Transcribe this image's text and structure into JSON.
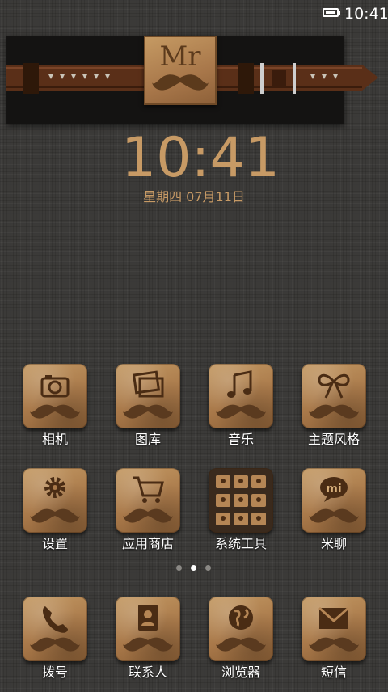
{
  "status_bar": {
    "time": "10:41",
    "battery_icon": "battery-icon"
  },
  "widget": {
    "tag_text": "Mr"
  },
  "clock": {
    "time": "10:41",
    "date": "星期四  07月11日"
  },
  "colors": {
    "clock": "#c79a65",
    "tile": "#a9794a",
    "mustache": "#5a3a1f"
  },
  "apps_page": [
    {
      "label": "相机",
      "icon": "camera-icon"
    },
    {
      "label": "图库",
      "icon": "gallery-icon"
    },
    {
      "label": "音乐",
      "icon": "music-note-icon"
    },
    {
      "label": "主题风格",
      "icon": "bow-icon"
    },
    {
      "label": "设置",
      "icon": "gear-icon"
    },
    {
      "label": "应用商店",
      "icon": "shopping-cart-icon"
    },
    {
      "label": "系统工具",
      "icon": "folder-icon"
    },
    {
      "label": "米聊",
      "icon": "chat-bubble-icon"
    }
  ],
  "pager": {
    "count": 3,
    "active": 2
  },
  "dock": [
    {
      "label": "拨号",
      "icon": "phone-icon"
    },
    {
      "label": "联系人",
      "icon": "contacts-icon"
    },
    {
      "label": "浏览器",
      "icon": "globe-icon"
    },
    {
      "label": "短信",
      "icon": "envelope-icon"
    }
  ]
}
